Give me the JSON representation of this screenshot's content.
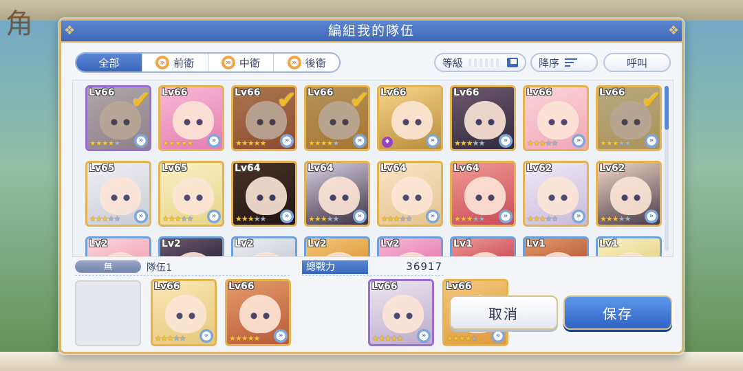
{
  "dialog": {
    "title": "編組我的隊伍"
  },
  "background": {
    "logo_text": "角"
  },
  "tabs": [
    {
      "label": "全部",
      "active": true,
      "icon": null
    },
    {
      "label": "前衛",
      "active": false,
      "icon": "position-chevron-icon"
    },
    {
      "label": "中衛",
      "active": false,
      "icon": "position-chevron-icon"
    },
    {
      "label": "後衛",
      "active": false,
      "icon": "position-chevron-icon"
    }
  ],
  "sort": {
    "level_label": "等級",
    "order_label": "降序",
    "call_label": "呼叫"
  },
  "grid": {
    "characters": [
      {
        "level": "Lv66",
        "stars": 4,
        "max_stars": 5,
        "selected": true,
        "frame": "purple",
        "theme": "c1"
      },
      {
        "level": "Lv66",
        "stars": 5,
        "max_stars": 5,
        "selected": false,
        "frame": "gold",
        "theme": "c2"
      },
      {
        "level": "Lv66",
        "stars": 5,
        "max_stars": 5,
        "selected": true,
        "frame": "gold",
        "theme": "c3"
      },
      {
        "level": "Lv66",
        "stars": 4,
        "max_stars": 5,
        "selected": true,
        "frame": "gold",
        "theme": "c4"
      },
      {
        "level": "Lv66",
        "stars": 0,
        "max_stars": 5,
        "selected": false,
        "frame": "gold",
        "theme": "c5",
        "unique_equip": true
      },
      {
        "level": "Lv66",
        "stars": 3,
        "max_stars": 5,
        "selected": false,
        "frame": "gold",
        "theme": "c6"
      },
      {
        "level": "Lv66",
        "stars": 3,
        "max_stars": 5,
        "selected": false,
        "frame": "gold",
        "theme": "c7"
      },
      {
        "level": "Lv66",
        "stars": 3,
        "max_stars": 5,
        "selected": true,
        "frame": "gold",
        "theme": "c8"
      },
      {
        "level": "Lv65",
        "stars": 3,
        "max_stars": 5,
        "selected": false,
        "frame": "gold",
        "theme": "c9"
      },
      {
        "level": "Lv65",
        "stars": 3,
        "max_stars": 5,
        "selected": false,
        "frame": "gold",
        "theme": "c10"
      },
      {
        "level": "Lv64",
        "stars": 3,
        "max_stars": 5,
        "selected": false,
        "frame": "gold",
        "theme": "c11"
      },
      {
        "level": "Lv64",
        "stars": 3,
        "max_stars": 5,
        "selected": false,
        "frame": "gold",
        "theme": "c12"
      },
      {
        "level": "Lv64",
        "stars": 3,
        "max_stars": 5,
        "selected": false,
        "frame": "gold",
        "theme": "c13"
      },
      {
        "level": "Lv64",
        "stars": 3,
        "max_stars": 5,
        "selected": false,
        "frame": "gold",
        "theme": "c14"
      },
      {
        "level": "Lv62",
        "stars": 3,
        "max_stars": 5,
        "selected": false,
        "frame": "gold",
        "theme": "c15"
      },
      {
        "level": "Lv62",
        "stars": 3,
        "max_stars": 5,
        "selected": false,
        "frame": "gold",
        "theme": "c16"
      },
      {
        "level": "Lv2",
        "partial": true,
        "frame": "blue",
        "theme": "c7"
      },
      {
        "level": "Lv2",
        "partial": true,
        "frame": "blue",
        "theme": "c6"
      },
      {
        "level": "Lv2",
        "partial": true,
        "frame": "blue",
        "theme": "c9"
      },
      {
        "level": "Lv2",
        "partial": true,
        "frame": "blue",
        "theme": "c4"
      },
      {
        "level": "Lv2",
        "partial": true,
        "frame": "blue",
        "theme": "c2"
      },
      {
        "level": "Lv1",
        "partial": true,
        "frame": "blue",
        "theme": "c14"
      },
      {
        "level": "Lv1",
        "partial": true,
        "frame": "blue",
        "theme": "c3"
      },
      {
        "level": "Lv1",
        "partial": true,
        "frame": "blue",
        "theme": "c10"
      }
    ]
  },
  "team": {
    "tag": "無",
    "name": "隊伍1",
    "power_label": "總戰力",
    "power_value": "36917",
    "members": [
      {
        "level": "Lv66",
        "stars": 3,
        "max_stars": 5,
        "frame": "gold",
        "theme": "c8"
      },
      {
        "level": "Lv66",
        "stars": 5,
        "max_stars": 5,
        "frame": "gold",
        "theme": "c3"
      },
      {
        "level": "Lv66",
        "stars": 5,
        "max_stars": 5,
        "frame": "purple",
        "theme": "c1"
      },
      {
        "level": "Lv66",
        "stars": 4,
        "max_stars": 5,
        "frame": "gold",
        "theme": "c4"
      }
    ]
  },
  "buttons": {
    "cancel": "取消",
    "save": "保存"
  },
  "colors": {
    "accent": "#3a66bb",
    "gold": "#e3b44f",
    "check": "#f3b920"
  }
}
